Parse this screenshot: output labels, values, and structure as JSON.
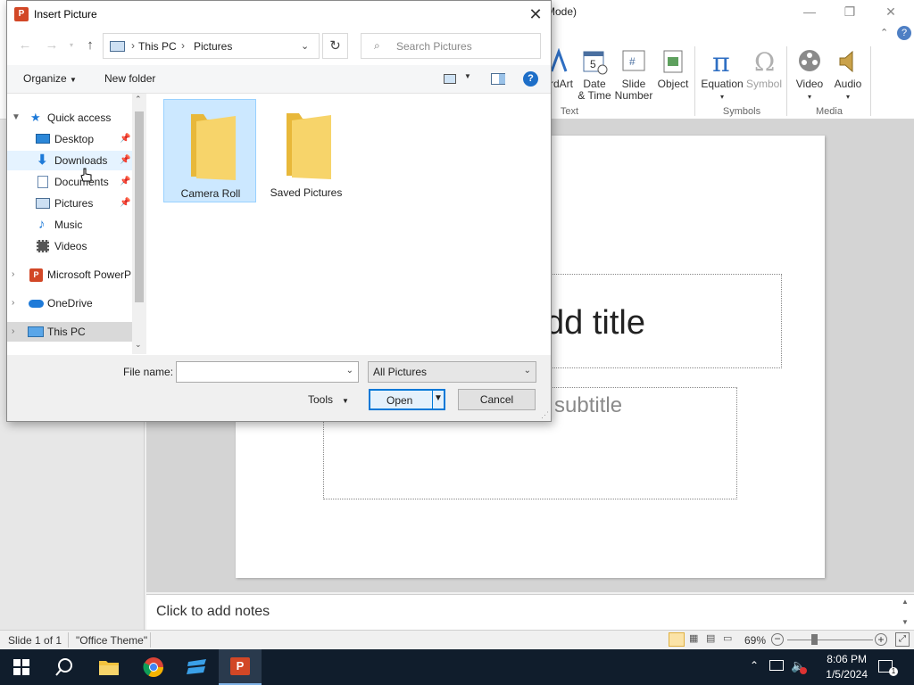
{
  "ppt": {
    "title_partial": "Mode)",
    "ribbon_buttons": {
      "wordart": "rdArt",
      "date_time": [
        "Date",
        "& Time"
      ],
      "slide_number": [
        "Slide",
        "Number"
      ],
      "object": "Object",
      "equation": "Equation",
      "symbol": "Symbol",
      "video": "Video",
      "audio": "Audio"
    },
    "groups": {
      "text": "Text",
      "symbols": "Symbols",
      "media": "Media"
    },
    "slide": {
      "title_placeholder": "dd title",
      "subtitle_placeholder": "subtitle"
    },
    "notes_placeholder": "Click to add notes",
    "status": {
      "slide_counter": "Slide 1 of 1",
      "theme": "\"Office Theme\"",
      "zoom": "69%"
    }
  },
  "dialog": {
    "title": "Insert Picture",
    "breadcrumb": [
      "This PC",
      "Pictures"
    ],
    "search_placeholder": "Search Pictures",
    "toolbar": {
      "organize": "Organize",
      "new_folder": "New folder"
    },
    "nav": {
      "quick_access": "Quick access",
      "items": [
        "Desktop",
        "Downloads",
        "Documents",
        "Pictures",
        "Music",
        "Videos"
      ],
      "microsoft_powerpoint": "Microsoft PowerP",
      "onedrive": "OneDrive",
      "this_pc": "This PC"
    },
    "folders": [
      "Camera Roll",
      "Saved Pictures"
    ],
    "file_name_label": "File name:",
    "file_name_value": "",
    "file_type": "All Pictures",
    "tools": "Tools",
    "open": "Open",
    "cancel": "Cancel"
  },
  "taskbar": {
    "time": "8:06 PM",
    "date": "1/5/2024"
  },
  "colors": {
    "accent": "#0078d7",
    "selection": "#cce8ff",
    "folder": "#f5c94a",
    "taskbar": "#101d2c"
  }
}
